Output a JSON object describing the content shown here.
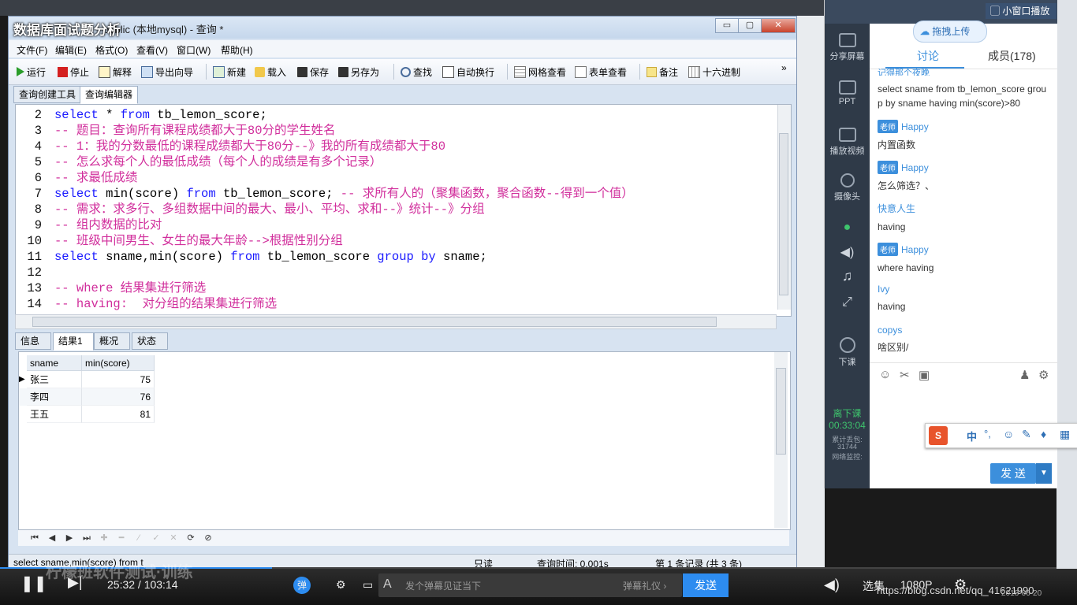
{
  "window": {
    "title": "public (本地mysql) - 查询 *",
    "overlay_title": "数据库面试题分析",
    "controls": {
      "minimize": "▭",
      "maximize": "▢",
      "close": "✕"
    }
  },
  "menubar": [
    "文件(F)",
    "编辑(E)",
    "格式(O)",
    "查看(V)",
    "窗口(W)",
    "帮助(H)"
  ],
  "toolbar": {
    "run": "运行",
    "stop": "停止",
    "explain": "解释",
    "export": "导出向导",
    "new": "新建",
    "load": "载入",
    "save": "保存",
    "save_as": "另存为",
    "find": "查找",
    "wrap": "自动换行",
    "grid_view": "网格查看",
    "form_view": "表单查看",
    "note": "备注",
    "hex": "十六进制",
    "more": "»"
  },
  "tabs_top": [
    "查询创建工具",
    "查询编辑器"
  ],
  "editor": {
    "lines": [
      {
        "n": "2",
        "parts": [
          [
            "kw",
            "select"
          ],
          [
            "t",
            " * "
          ],
          [
            "kw",
            "from"
          ],
          [
            "t",
            " tb_lemon_score;"
          ]
        ]
      },
      {
        "n": "3",
        "parts": [
          [
            "cm",
            "-- 题目：查询所有课程成绩都大于80分的学生姓名"
          ]
        ]
      },
      {
        "n": "4",
        "parts": [
          [
            "cm",
            "-- 1：我的分数最低的课程成绩都大于80分--》我的所有成绩都大于80"
          ]
        ]
      },
      {
        "n": "5",
        "parts": [
          [
            "cm",
            "-- 怎么求每个人的最低成绩（每个人的成绩是有多个记录）"
          ]
        ]
      },
      {
        "n": "6",
        "parts": [
          [
            "cm",
            "-- 求最低成绩"
          ]
        ]
      },
      {
        "n": "7",
        "parts": [
          [
            "kw",
            "select"
          ],
          [
            "t",
            " min(score) "
          ],
          [
            "kw",
            "from"
          ],
          [
            "t",
            " tb_lemon_score; "
          ],
          [
            "cm",
            "-- 求所有人的（聚集函数，聚合函数--得到一个值）"
          ]
        ]
      },
      {
        "n": "8",
        "parts": [
          [
            "cm",
            "-- 需求：求多行、多组数据中间的最大、最小、平均、求和--》统计--》分组"
          ]
        ]
      },
      {
        "n": "9",
        "parts": [
          [
            "cm",
            "-- 组内数据的比对"
          ]
        ]
      },
      {
        "n": "10",
        "parts": [
          [
            "cm",
            "-- 班级中间男生、女生的最大年龄-->根据性别分组"
          ]
        ]
      },
      {
        "n": "11",
        "parts": [
          [
            "kw",
            "select"
          ],
          [
            "t",
            " sname,min(score) "
          ],
          [
            "kw",
            "from"
          ],
          [
            "t",
            " tb_lemon_score "
          ],
          [
            "kw",
            "group by"
          ],
          [
            "t",
            " sname;"
          ]
        ]
      },
      {
        "n": "12",
        "parts": []
      },
      {
        "n": "13",
        "parts": [
          [
            "cm",
            "-- where 结果集进行筛选"
          ]
        ]
      },
      {
        "n": "14",
        "parts": [
          [
            "cm",
            "-- having:  对分组的结果集进行筛选"
          ]
        ]
      }
    ]
  },
  "tabs_bottom": [
    "信息",
    "结果1",
    "概况",
    "状态"
  ],
  "grid": {
    "columns": [
      "sname",
      "min(score)"
    ],
    "rows": [
      [
        "张三",
        "75"
      ],
      [
        "李四",
        "76"
      ],
      [
        "王五",
        "81"
      ]
    ]
  },
  "statusbar": {
    "sql": "select sname,min(score) from t",
    "mode": "只读",
    "query_time": "查询时间: 0.001s",
    "records": "第 1 条记录 (共 3 条)"
  },
  "chat": {
    "mini_window": "小窗口播放",
    "drag_upload": "拖拽上传",
    "share_screen": "分享屏幕",
    "side": [
      "PPT",
      "播放视频",
      "摄像头"
    ],
    "end_class": "下课",
    "leave": "离下课",
    "timer": "00:33:04",
    "lost_packets_label": "累计丢包:",
    "lost_packets": "31744",
    "net_monitor": "网络监控:",
    "tabs": {
      "discuss": "讨论",
      "members": "成员(178)"
    },
    "top_snippet": "记得那个夜晚",
    "messages": [
      {
        "name": "",
        "badge": "",
        "text": "select sname from tb_lemon_score group by sname having min(score)>80"
      },
      {
        "name": "Happy",
        "badge": "老师",
        "text": "内置函数"
      },
      {
        "name": "Happy",
        "badge": "老师",
        "text": "怎么筛选？、"
      },
      {
        "name": "快意人生",
        "badge": "",
        "text": "having"
      },
      {
        "name": "Happy",
        "badge": "老师",
        "text": "where having"
      },
      {
        "name": "Ivy",
        "badge": "",
        "text": "having"
      },
      {
        "name": "copys",
        "badge": "",
        "text": "啥区别/"
      }
    ],
    "send": "发 送",
    "badge_label": "老师"
  },
  "video": {
    "time": "25:32 / 103:14",
    "danmu_placeholder": "发个弹幕见证当下",
    "danmu_gift": "弹幕礼仪 ›",
    "danmu_send": "发送",
    "danmu_toggle": "弹",
    "select_set": "选集",
    "quality": "1080P",
    "watermark": "https://blog.csdn.net/qq_41621990",
    "date": "2018-06-20",
    "overlay_course": "柠檬班软件测试·训练"
  },
  "ime": {
    "label": "中",
    "punct": "°,"
  }
}
